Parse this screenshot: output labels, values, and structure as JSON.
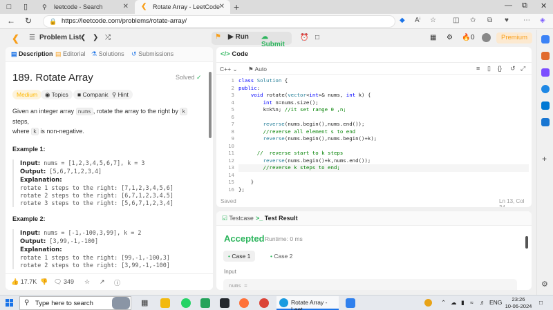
{
  "browser": {
    "tabs": [
      {
        "title": "leetcode - Search",
        "active": false
      },
      {
        "title": "Rotate Array - LeetCode",
        "active": true
      }
    ],
    "url": "https://leetcode.com/problems/rotate-array/"
  },
  "header": {
    "problem_list": "Problem List",
    "run": "Run",
    "submit": "Submit",
    "streak_count": "0",
    "premium": "Premium"
  },
  "left": {
    "tabs": [
      "Description",
      "Editorial",
      "Solutions",
      "Submissions"
    ],
    "title": "189. Rotate Array",
    "solved": "Solved",
    "pills": [
      "Medium",
      "Topics",
      "Companies",
      "Hint"
    ],
    "desc_1": "Given an integer array",
    "desc_code1": "nums",
    "desc_2": ", rotate the array to the right by",
    "desc_code2": "k",
    "desc_3": "steps,",
    "desc_4": "where",
    "desc_code3": "k",
    "desc_5": "is non-negative.",
    "example1": {
      "heading": "Example 1:",
      "input_label": "Input:",
      "input": "nums = [1,2,3,4,5,6,7], k = 3",
      "output_label": "Output:",
      "output": "[5,6,7,1,2,3,4]",
      "explanation_label": "Explanation:",
      "lines": [
        "rotate 1 steps to the right: [7,1,2,3,4,5,6]",
        "rotate 2 steps to the right: [6,7,1,2,3,4,5]",
        "rotate 3 steps to the right: [5,6,7,1,2,3,4]"
      ]
    },
    "example2": {
      "heading": "Example 2:",
      "input_label": "Input:",
      "input": "nums = [-1,-100,3,99], k = 2",
      "output_label": "Output:",
      "output": "[3,99,-1,-100]",
      "explanation_label": "Explanation:",
      "lines": [
        "rotate 1 steps to the right: [99,-1,-100,3]",
        "rotate 2 steps to the right: [3,99,-1,-100]"
      ]
    },
    "footer": {
      "likes": "17.7K",
      "comments": "349"
    }
  },
  "code": {
    "title": "Code",
    "language": "C++",
    "mode": "Auto",
    "lines": [
      "class Solution {",
      "public:",
      "    void rotate(vector<int>& nums, int k) {",
      "        int n=nums.size();",
      "        k=k%n; //it set range 0 ,n;",
      "",
      "        reverse(nums.begin(),nums.end());",
      "        //reverse all element s to end",
      "        reverse(nums.begin(),nums.begin()+k);",
      "",
      "      //  reverse start to k steps",
      "        reverse(nums.begin()+k,nums.end());",
      "        //reverse k steps to end;",
      "",
      "    }",
      "};"
    ],
    "active_line": 13,
    "saved": "Saved",
    "cursor": "Ln 13, Col 34"
  },
  "result": {
    "tab_testcase": "Testcase",
    "tab_result": "Test Result",
    "status": "Accepted",
    "runtime": "Runtime: 0 ms",
    "cases": [
      "Case 1",
      "Case 2"
    ],
    "input_label": "Input",
    "input_value": "nums ="
  },
  "taskbar": {
    "search_placeholder": "Type here to search",
    "active_app": "Rotate Array - Leet...",
    "lang": "ENG",
    "time": "23:26",
    "date": "10-06-2024"
  },
  "colors": {
    "accepted": "#2db55d",
    "medium": "#ffb800",
    "premium": "#f89f1b",
    "keyword": "#0000ff",
    "comment": "#008000"
  }
}
